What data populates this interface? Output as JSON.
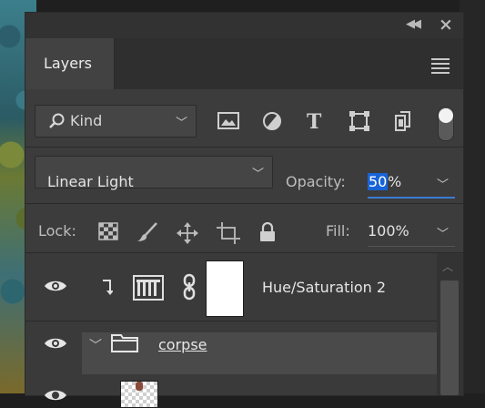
{
  "panel": {
    "tab_label": "Layers"
  },
  "filter": {
    "kind_label": "Kind"
  },
  "blend": {
    "mode": "Linear Light",
    "opacity_label": "Opacity:",
    "opacity_selected": "50",
    "opacity_suffix": "%"
  },
  "lock": {
    "label": "Lock:",
    "fill_label": "Fill:",
    "fill_value": "100%"
  },
  "layers": [
    {
      "name": "Hue/Saturation 2",
      "type": "adjustment",
      "visible": true
    },
    {
      "name": "corpse",
      "type": "group",
      "visible": true,
      "selected": true
    },
    {
      "name": "",
      "type": "pixel",
      "visible": true
    }
  ],
  "colors": {
    "panel_bg": "#3c3c3c",
    "selection_blue": "#1864d6",
    "focus_underline": "#3b7bd4"
  }
}
